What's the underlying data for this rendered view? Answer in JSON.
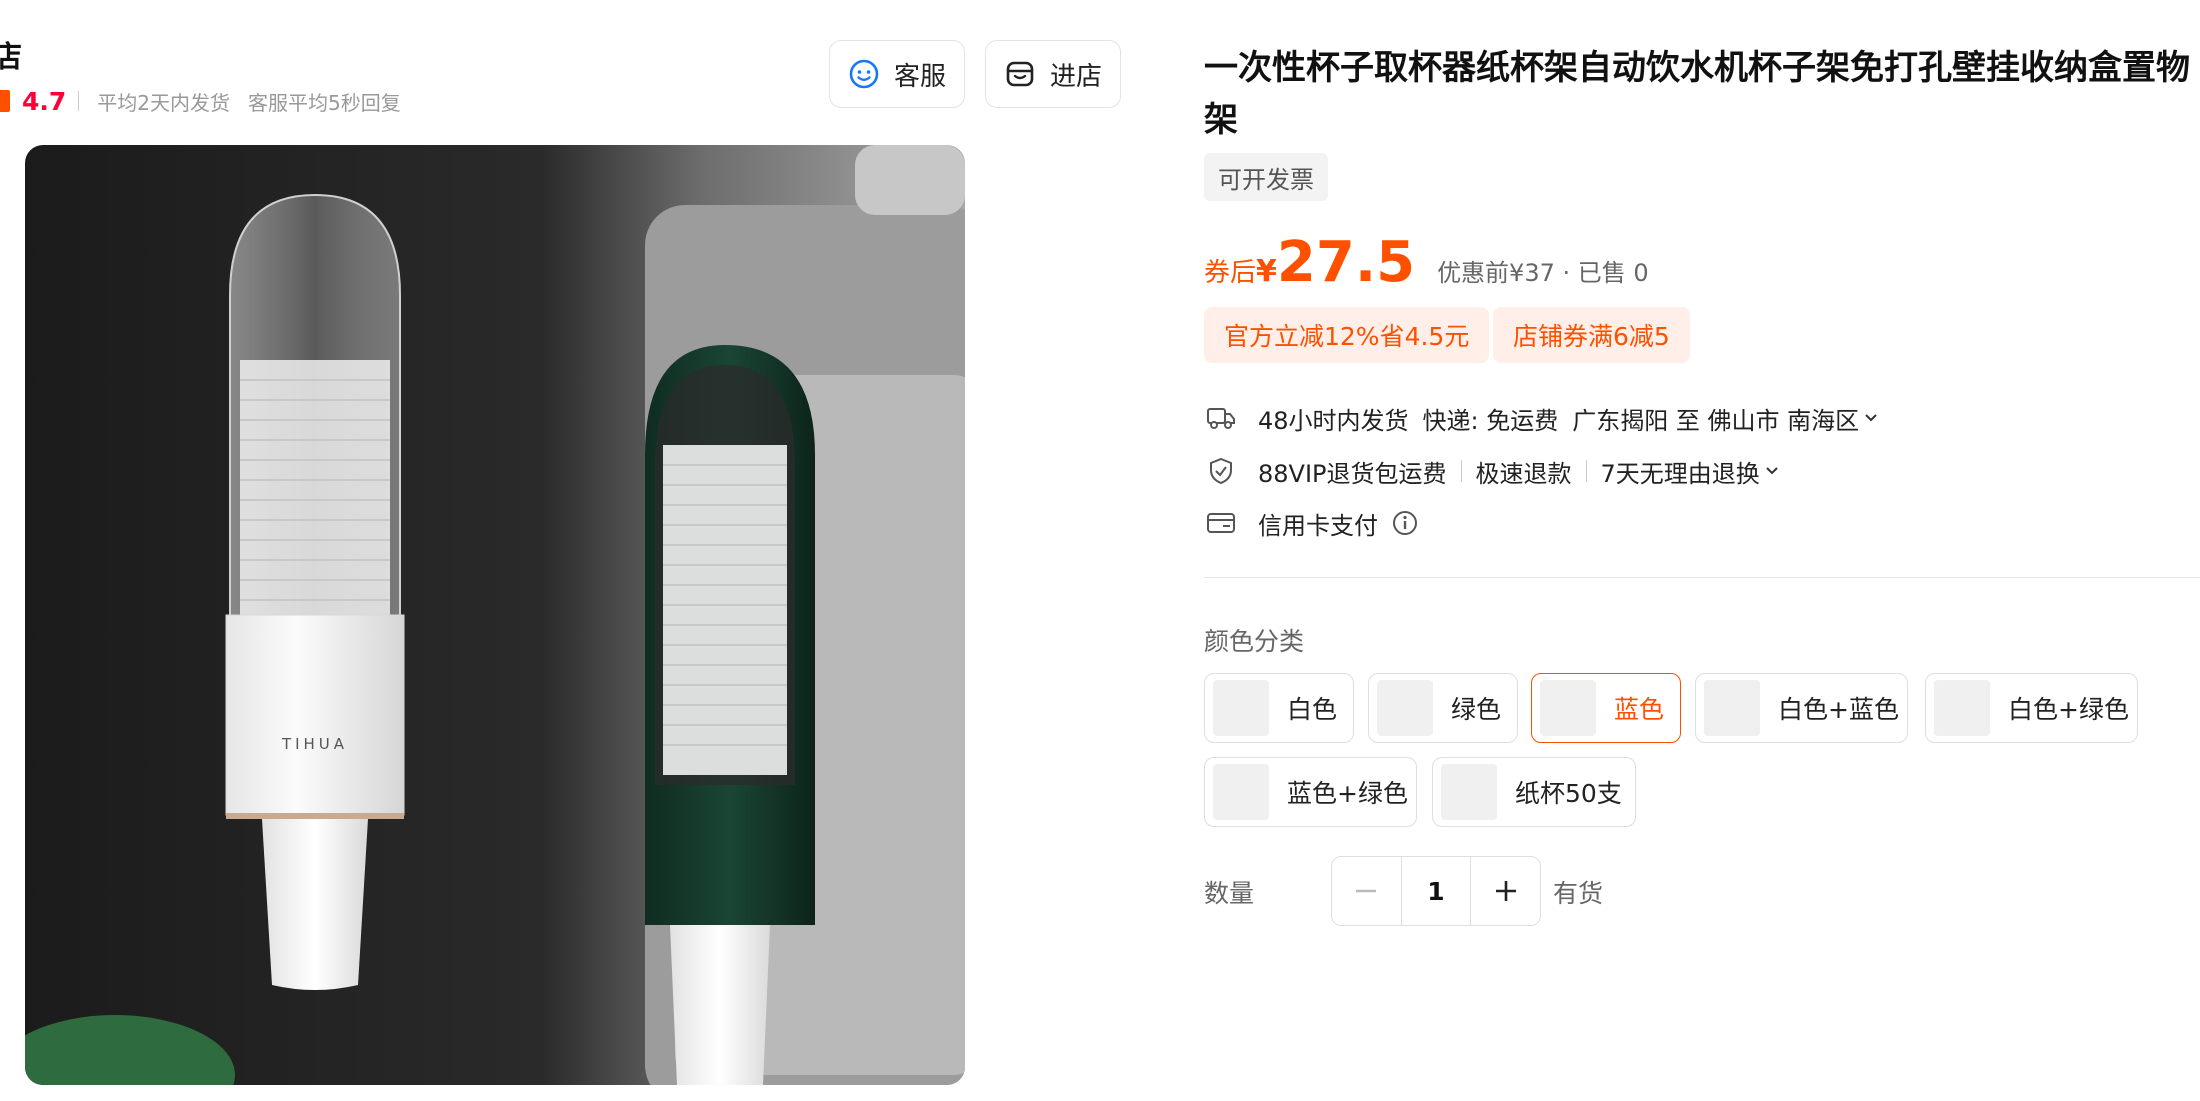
{
  "shop": {
    "name": "店",
    "rating": "4.7",
    "stats": [
      "平均2天内发货",
      "客服平均5秒回复"
    ]
  },
  "header_buttons": {
    "service_label": "客服",
    "store_label": "进店"
  },
  "product_image": {
    "brand_text": "TIHUA",
    "background_color": "#1e1e1e",
    "white_unit_color": "#f7f7f7",
    "green_unit_color": "#143a2c"
  },
  "product": {
    "title": "一次性杯子取杯器纸杯架自动饮水机杯子架免打孔壁挂收纳盒置物架",
    "invoice_tag": "可开发票"
  },
  "price": {
    "prefix": "券后",
    "currency": "¥",
    "value": "27.5",
    "original": "优惠前¥37 · 已售 0"
  },
  "promotions": [
    "官方立减12%省4.5元",
    "店铺券满6减5"
  ],
  "shipping": {
    "time": "48小时内发货",
    "express": "快递: 免运费",
    "route": "广东揭阳 至 佛山市 南海区"
  },
  "services": [
    "88VIP退货包运费",
    "极速退款",
    "7天无理由退换"
  ],
  "payment": {
    "label": "信用卡支付"
  },
  "color_section": {
    "label": "颜色分类",
    "options": [
      "白色",
      "绿色",
      "蓝色",
      "白色+蓝色",
      "白色+绿色",
      "蓝色+绿色",
      "纸杯50支"
    ],
    "selected": "蓝色"
  },
  "quantity": {
    "label": "数量",
    "value": "1",
    "stock": "有货"
  },
  "colors": {
    "accent": "#ff5000",
    "rating": "#ff0036",
    "promo_bg": "#ffefe8"
  },
  "icons": [
    "smiley-icon",
    "store-icon",
    "truck-icon",
    "shield-icon",
    "card-icon",
    "info-icon",
    "chevron-down-icon",
    "minus-icon",
    "plus-icon"
  ]
}
